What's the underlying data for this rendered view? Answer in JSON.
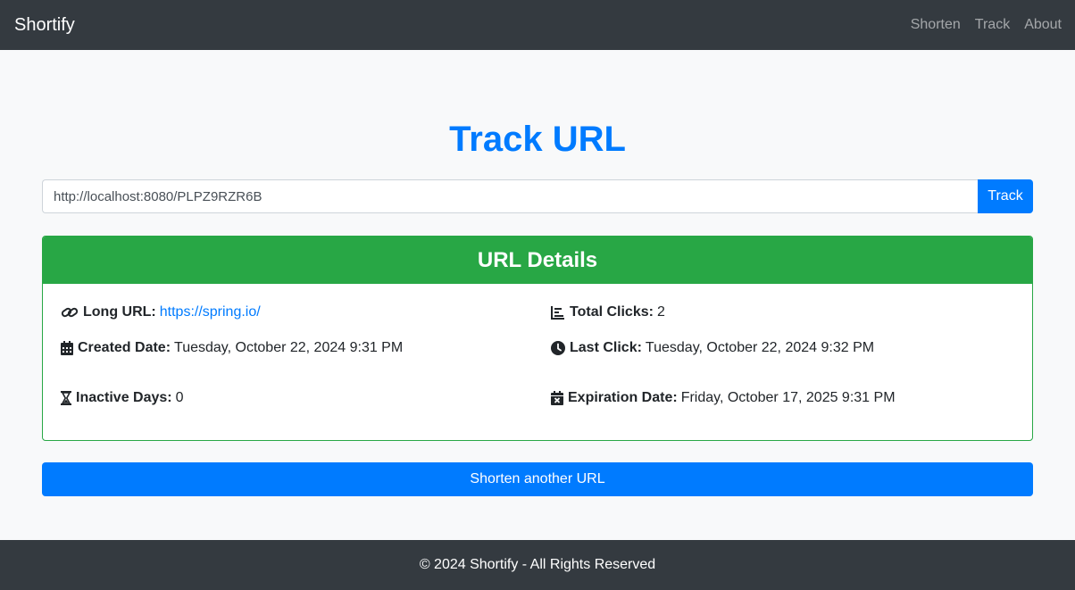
{
  "navbar": {
    "brand": "Shortify",
    "links": [
      "Shorten",
      "Track",
      "About"
    ]
  },
  "page": {
    "title": "Track URL"
  },
  "track_form": {
    "input_value": "http://localhost:8080/PLPZ9RZR6B",
    "button_label": "Track"
  },
  "details": {
    "header": "URL Details",
    "long_url_label": "Long URL:",
    "long_url_value": "https://spring.io/",
    "total_clicks_label": "Total Clicks:",
    "total_clicks_value": "2",
    "created_label": "Created Date:",
    "created_value": "Tuesday, October 22, 2024 9:31 PM",
    "last_click_label": "Last Click:",
    "last_click_value": "Tuesday, October 22, 2024 9:32 PM",
    "inactive_label": "Inactive Days:",
    "inactive_value": "0",
    "expiration_label": "Expiration Date:",
    "expiration_value": "Friday, October 17, 2025 9:31 PM",
    "icons": [
      "link-icon",
      "chart-icon",
      "calendar-icon",
      "clock-icon",
      "hourglass-icon",
      "calendar-x-icon"
    ]
  },
  "actions": {
    "shorten_another": "Shorten another URL"
  },
  "footer": {
    "text": "© 2024 Shortify - All Rights Reserved"
  },
  "colors": {
    "navbar": "#343a40",
    "primary": "#007bff",
    "success": "#28a745",
    "background": "#f8f9fa"
  }
}
